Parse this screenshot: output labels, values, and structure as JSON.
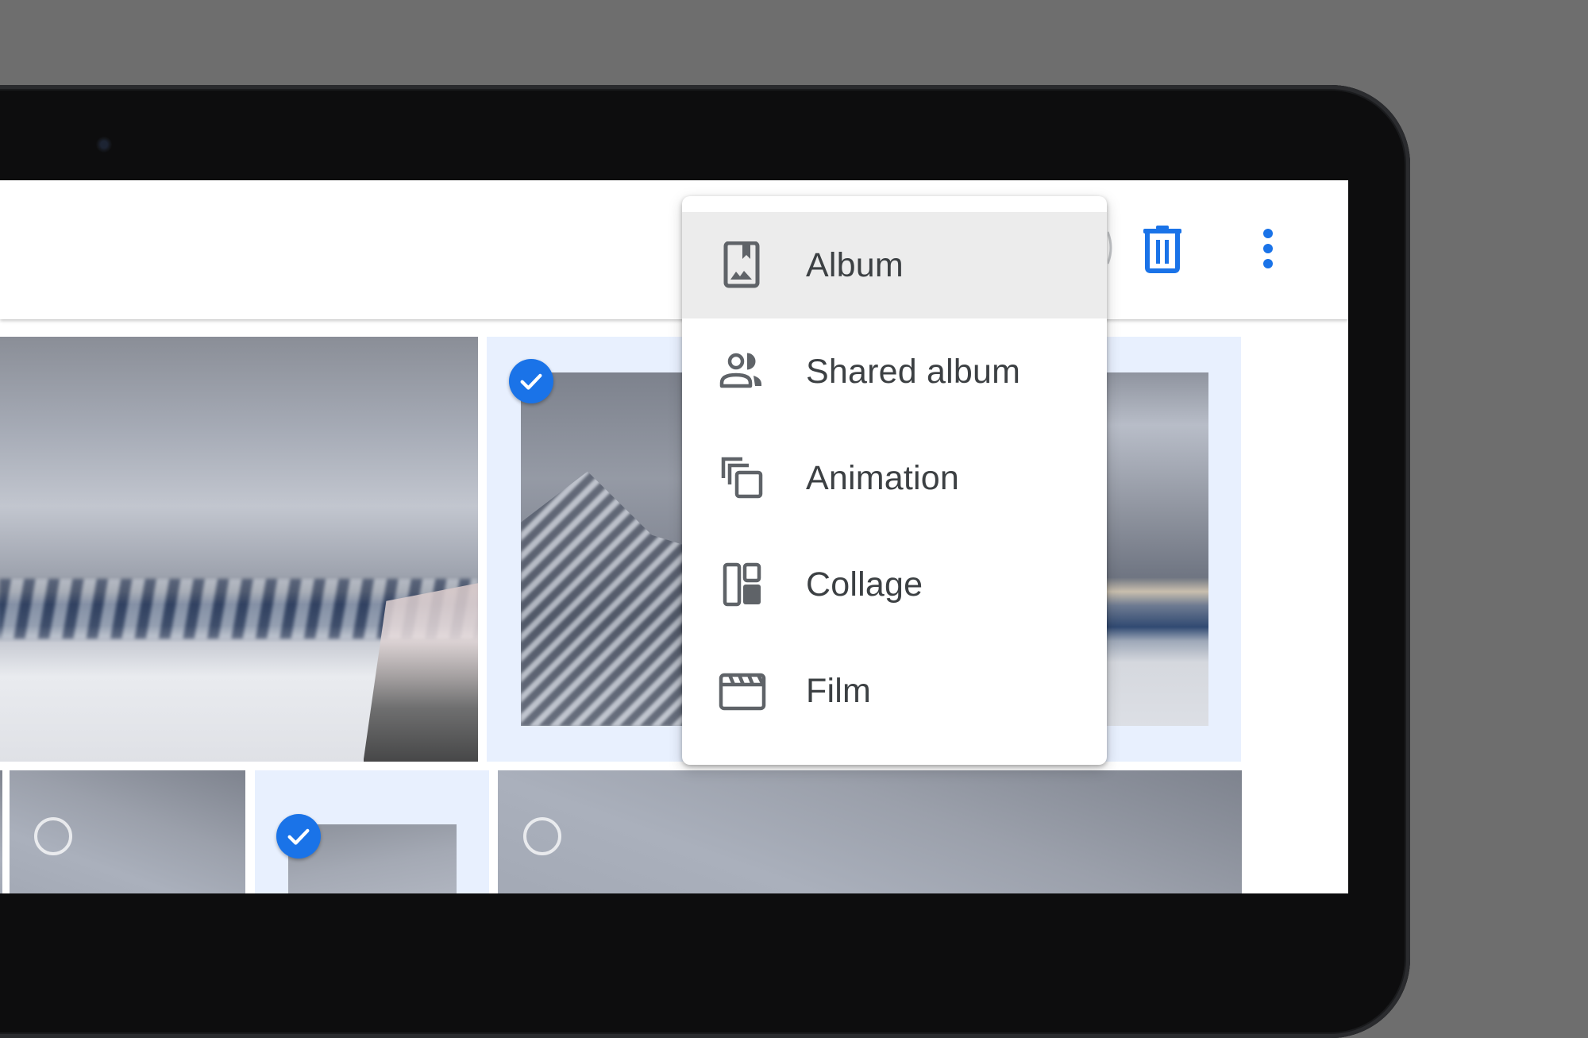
{
  "colors": {
    "accent": "#1a73e8",
    "selected_tile_bg": "#e8f0fe",
    "menu_text": "#3c4043",
    "menu_icon": "#5f6368",
    "menu_hover": "#ececec",
    "backdrop": "#6e6e6e"
  },
  "toolbar": {
    "buttons": [
      {
        "icon": "add-icon",
        "state": "partially-hidden"
      },
      {
        "icon": "trash-icon",
        "label": "Delete"
      },
      {
        "icon": "more-vert-icon",
        "label": "More options"
      }
    ]
  },
  "create_menu": {
    "items": [
      {
        "label": "Album",
        "icon": "album-icon",
        "highlighted": true
      },
      {
        "label": "Shared album",
        "icon": "shared-album-icon",
        "highlighted": false
      },
      {
        "label": "Animation",
        "icon": "animation-icon",
        "highlighted": false
      },
      {
        "label": "Collage",
        "icon": "collage-icon",
        "highlighted": false
      },
      {
        "label": "Film",
        "icon": "film-icon",
        "highlighted": false
      }
    ]
  },
  "photos": [
    {
      "id": "panorama-snow-ridge",
      "selected": false
    },
    {
      "id": "mountain-peak-railing",
      "selected": true
    },
    {
      "id": "row2-sliver",
      "selected": false
    },
    {
      "id": "overcast-sky-1",
      "selected": false
    },
    {
      "id": "overcast-sky-2",
      "selected": true
    },
    {
      "id": "overcast-sky-wide",
      "selected": false
    }
  ]
}
